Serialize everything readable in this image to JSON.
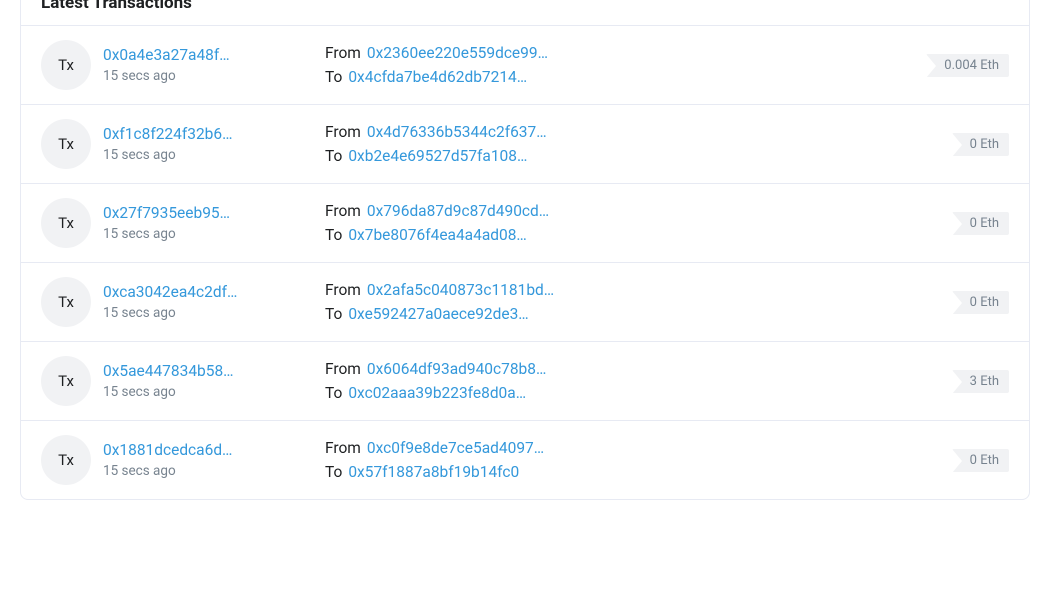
{
  "section_title": "Latest Transactions",
  "tx_icon_label": "Tx",
  "from_label": "From",
  "to_label": "To",
  "eth_unit": "Eth",
  "transactions": [
    {
      "hash": "0x0a4e3a27a48f…",
      "time": "15 secs ago",
      "from": "0x2360ee220e559dce99…",
      "to": "0x4cfda7be4d62db7214…",
      "value": "0.004"
    },
    {
      "hash": "0xf1c8f224f32b6…",
      "time": "15 secs ago",
      "from": "0x4d76336b5344c2f637…",
      "to": "0xb2e4e69527d57fa108…",
      "value": "0"
    },
    {
      "hash": "0x27f7935eeb95…",
      "time": "15 secs ago",
      "from": "0x796da87d9c87d490cd…",
      "to": "0x7be8076f4ea4a4ad08…",
      "value": "0"
    },
    {
      "hash": "0xca3042ea4c2df…",
      "time": "15 secs ago",
      "from": "0x2afa5c040873c1181bd…",
      "to": "0xe592427a0aece92de3…",
      "value": "0"
    },
    {
      "hash": "0x5ae447834b58…",
      "time": "15 secs ago",
      "from": "0x6064df93ad940c78b8…",
      "to": "0xc02aaa39b223fe8d0a…",
      "value": "3"
    },
    {
      "hash": "0x1881dcedca6d…",
      "time": "15 secs ago",
      "from": "0xc0f9e8de7ce5ad4097…",
      "to": "0x57f1887a8bf19b14fc0",
      "value": "0"
    }
  ]
}
